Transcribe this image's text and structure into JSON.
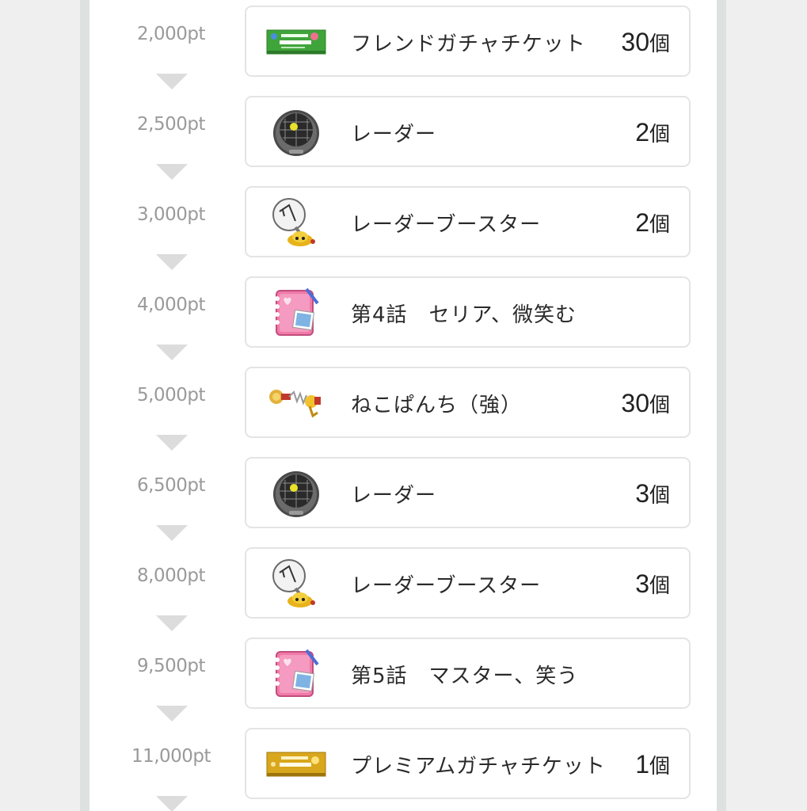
{
  "rewards": [
    {
      "points": "2,000pt",
      "name": "フレンドガチャチケット",
      "qty": "30",
      "unit": "個",
      "icon": "friend-ticket-icon"
    },
    {
      "points": "2,500pt",
      "name": "レーダー",
      "qty": "2",
      "unit": "個",
      "icon": "radar-icon"
    },
    {
      "points": "3,000pt",
      "name": "レーダーブースター",
      "qty": "2",
      "unit": "個",
      "icon": "radar-booster-icon"
    },
    {
      "points": "4,000pt",
      "name": "第4話　セリア、微笑む",
      "qty": "",
      "unit": "",
      "icon": "story-book-icon"
    },
    {
      "points": "5,000pt",
      "name": "ねこぱんち（強）",
      "qty": "30",
      "unit": "個",
      "icon": "cat-punch-icon"
    },
    {
      "points": "6,500pt",
      "name": "レーダー",
      "qty": "3",
      "unit": "個",
      "icon": "radar-icon"
    },
    {
      "points": "8,000pt",
      "name": "レーダーブースター",
      "qty": "3",
      "unit": "個",
      "icon": "radar-booster-icon"
    },
    {
      "points": "9,500pt",
      "name": "第5話　マスター、笑う",
      "qty": "",
      "unit": "",
      "icon": "story-book-icon"
    },
    {
      "points": "11,000pt",
      "name": "プレミアムガチャチケット",
      "qty": "1",
      "unit": "個",
      "icon": "premium-ticket-icon"
    }
  ]
}
